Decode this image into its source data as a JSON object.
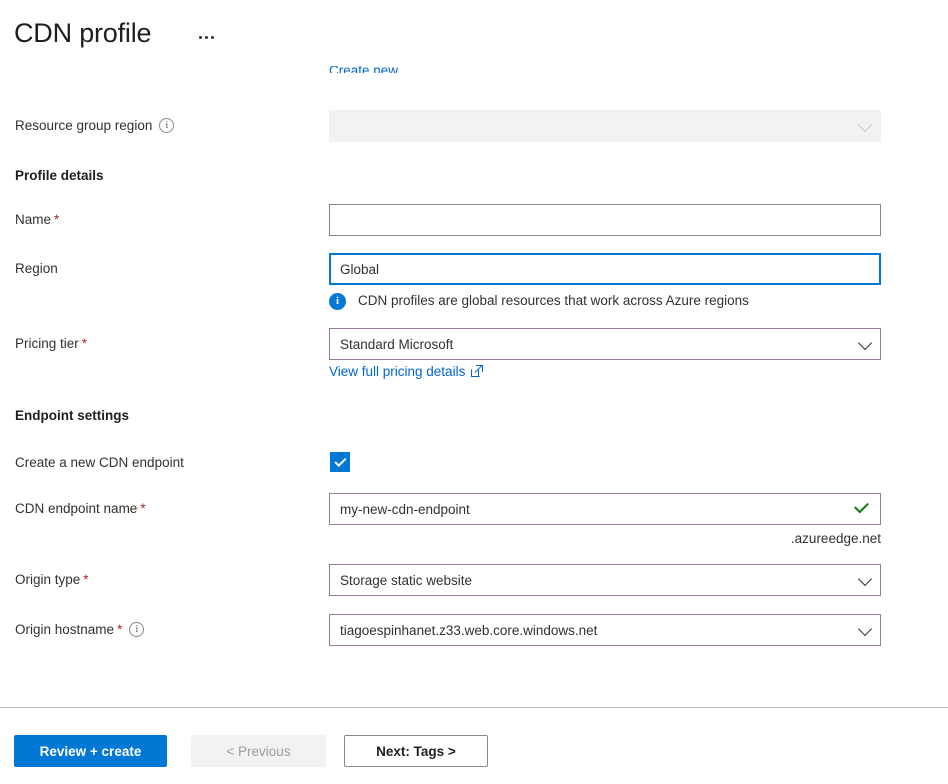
{
  "header": {
    "title": "CDN profile",
    "more_menu_label": "More options"
  },
  "form": {
    "cut_off_link": "Create new",
    "fields": {
      "resource_group_region": {
        "label": "Resource group region",
        "value": "",
        "disabled": true,
        "has_info_icon": true
      },
      "profile_details_header": "Profile details",
      "name": {
        "label": "Name",
        "required": true,
        "value": "",
        "placeholder": ""
      },
      "region": {
        "label": "Region",
        "value": "Global",
        "focused": true
      },
      "region_hint": "CDN profiles are global resources that work across Azure regions",
      "pricing_tier": {
        "label": "Pricing tier",
        "required": true,
        "value": "Standard Microsoft"
      },
      "pricing_link": "View full pricing details",
      "endpoint_settings_header": "Endpoint settings",
      "create_endpoint": {
        "label": "Create a new CDN endpoint",
        "checked": true
      },
      "endpoint_name": {
        "label": "CDN endpoint name",
        "required": true,
        "value": "my-new-cdn-endpoint",
        "valid": true,
        "suffix": ".azureedge.net"
      },
      "origin_type": {
        "label": "Origin type",
        "required": true,
        "value": "Storage static website"
      },
      "origin_hostname": {
        "label": "Origin hostname",
        "required": true,
        "value": "tiagoespinhanet.z33.web.core.windows.net",
        "has_info_icon": true
      }
    }
  },
  "footer": {
    "review_create": "Review + create",
    "previous": "< Previous",
    "next": "Next: Tags >"
  },
  "colors": {
    "accent": "#0078d4",
    "link": "#0066cc",
    "required": "#a4262c",
    "valid": "#107c10",
    "modified_border": "#9b7b9b",
    "disabled_bg": "#f3f2f1"
  }
}
